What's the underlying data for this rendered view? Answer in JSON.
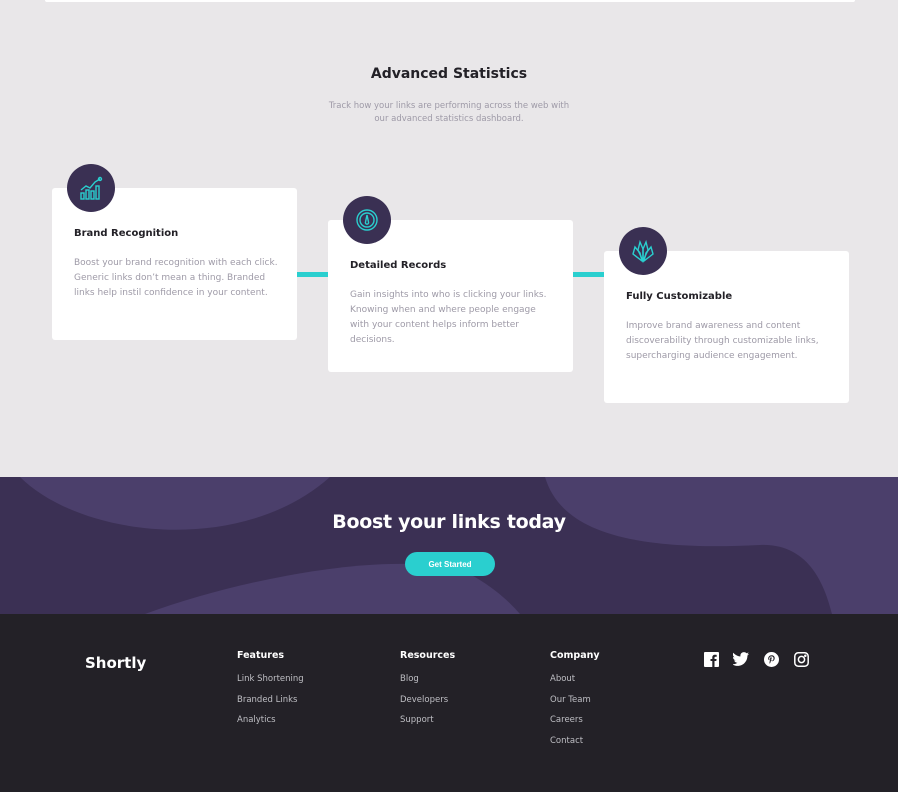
{
  "stats": {
    "title": "Advanced Statistics",
    "subtitle_line1": "Track how your links are performing across the web with",
    "subtitle_line2": "our advanced statistics dashboard.",
    "cards": [
      {
        "title": "Brand Recognition",
        "icon": "chart-icon",
        "body": "Boost your brand recognition with each click. Generic links don’t mean a thing. Branded links help instil confidence in your content."
      },
      {
        "title": "Detailed Records",
        "icon": "gauge-icon",
        "body": "Gain insights into who is clicking your links. Knowing when and where people engage with your content helps inform better decisions."
      },
      {
        "title": "Fully Customizable",
        "icon": "brushes-icon",
        "body": "Improve brand awareness and content discoverability through customizable links, supercharging audience engagement."
      }
    ]
  },
  "cta": {
    "title": "Boost your links today",
    "button_label": "Get Started"
  },
  "footer": {
    "logo": "Shortly",
    "columns": [
      {
        "heading": "Features",
        "links": [
          "Link Shortening",
          "Branded Links",
          "Analytics"
        ]
      },
      {
        "heading": "Resources",
        "links": [
          "Blog",
          "Developers",
          "Support"
        ]
      },
      {
        "heading": "Company",
        "links": [
          "About",
          "Our Team",
          "Careers",
          "Contact"
        ]
      }
    ],
    "social": [
      "facebook-icon",
      "twitter-icon",
      "pinterest-icon",
      "instagram-icon"
    ]
  },
  "colors": {
    "accent": "#2acfcf",
    "dark_violet": "#3b3054",
    "very_dark": "#232127",
    "gray_text": "#9e9aa7"
  }
}
